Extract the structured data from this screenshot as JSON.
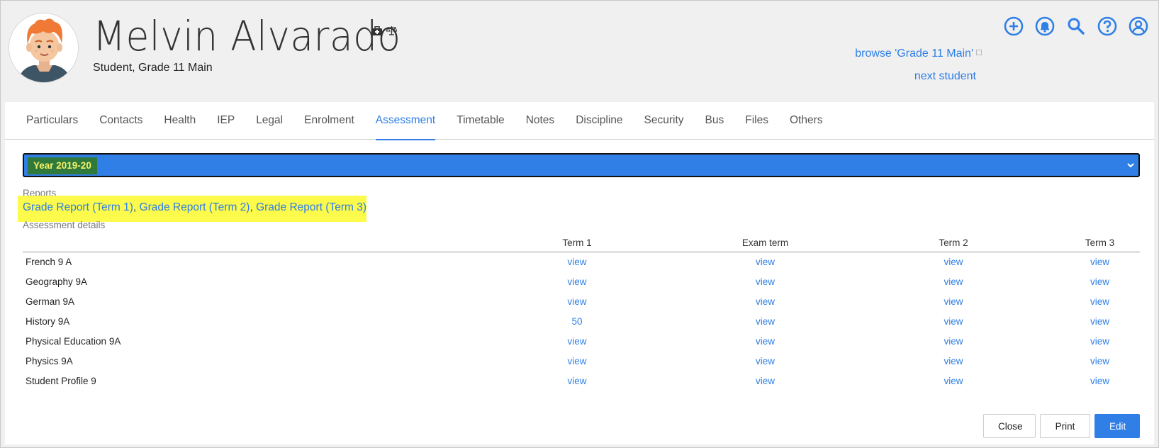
{
  "student": {
    "name": "Melvin Alvarado",
    "role": "Student, Grade 11 Main",
    "browse_link": "browse 'Grade 11 Main'",
    "next_link": "next student"
  },
  "icons": {
    "medical": "medical-kit-icon",
    "legal": "scales-icon",
    "add": "plus-circle-icon",
    "notifications": "bell-icon",
    "search": "search-icon",
    "help": "help-circle-icon",
    "account": "user-circle-icon"
  },
  "tabs": [
    {
      "label": "Particulars"
    },
    {
      "label": "Contacts"
    },
    {
      "label": "Health"
    },
    {
      "label": "IEP"
    },
    {
      "label": "Legal"
    },
    {
      "label": "Enrolment"
    },
    {
      "label": "Assessment",
      "active": true
    },
    {
      "label": "Timetable"
    },
    {
      "label": "Notes"
    },
    {
      "label": "Discipline"
    },
    {
      "label": "Security"
    },
    {
      "label": "Bus"
    },
    {
      "label": "Files"
    },
    {
      "label": "Others"
    }
  ],
  "year": {
    "selected": "Year 2019-20"
  },
  "reports": {
    "label": "Reports",
    "links": [
      "Grade Report (Term 1)",
      "Grade Report (Term 2)",
      "Grade Report (Term 3)"
    ],
    "separator": ", "
  },
  "assessment": {
    "label": "Assessment details",
    "columns": [
      "Term 1",
      "Exam term",
      "Term 2",
      "Term 3"
    ],
    "rows": [
      {
        "subject": "French 9 A",
        "values": [
          "view",
          "view",
          "view",
          "view"
        ]
      },
      {
        "subject": "Geography 9A",
        "values": [
          "view",
          "view",
          "view",
          "view"
        ]
      },
      {
        "subject": "German 9A",
        "values": [
          "view",
          "view",
          "view",
          "view"
        ]
      },
      {
        "subject": "History 9A",
        "values": [
          "50",
          "view",
          "view",
          "view"
        ]
      },
      {
        "subject": "Physical Education 9A",
        "values": [
          "view",
          "view",
          "view",
          "view"
        ]
      },
      {
        "subject": "Physics 9A",
        "values": [
          "view",
          "view",
          "view",
          "view"
        ]
      },
      {
        "subject": "Student Profile 9",
        "values": [
          "view",
          "view",
          "view",
          "view"
        ]
      }
    ]
  },
  "buttons": {
    "close": "Close",
    "print": "Print",
    "edit": "Edit"
  },
  "colors": {
    "accent": "#2f7fe6",
    "highlight": "#fcfa4a",
    "year_badge_bg": "#2f7a3a",
    "year_badge_text": "#f5f06a"
  }
}
